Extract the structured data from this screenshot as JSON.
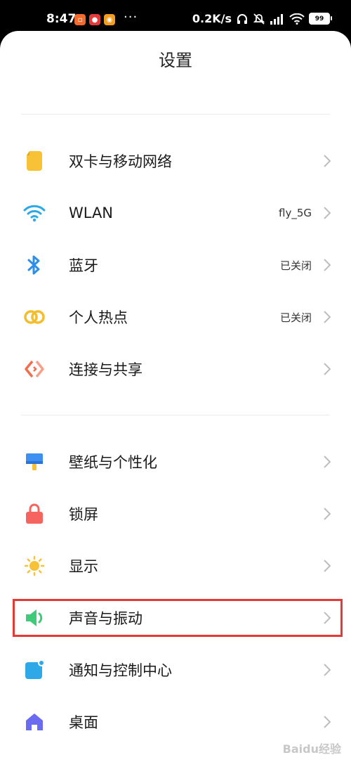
{
  "status_bar": {
    "time": "8:47",
    "more": "···",
    "net_speed": "0.2K/s",
    "battery": "99"
  },
  "page": {
    "title": "设置"
  },
  "section1": [
    {
      "label": "双卡与移动网络",
      "value": "",
      "icon": "sim-card-icon",
      "color": "#F7C235"
    },
    {
      "label": "WLAN",
      "value": "fly_5G",
      "icon": "wifi-icon",
      "color": "#2FA8E8"
    },
    {
      "label": "蓝牙",
      "value": "已关闭",
      "icon": "bluetooth-icon",
      "color": "#2F8FE8"
    },
    {
      "label": "个人热点",
      "value": "已关闭",
      "icon": "hotspot-icon",
      "color": "#F2BE2C"
    },
    {
      "label": "连接与共享",
      "value": "",
      "icon": "connection-share-icon",
      "color": "#F06E4E"
    }
  ],
  "section2": [
    {
      "label": "壁纸与个性化",
      "value": "",
      "icon": "wallpaper-icon",
      "color": "#3E8FF2"
    },
    {
      "label": "锁屏",
      "value": "",
      "icon": "lock-icon",
      "color": "#F5645E"
    },
    {
      "label": "显示",
      "value": "",
      "icon": "brightness-icon",
      "color": "#F7C235"
    },
    {
      "label": "声音与振动",
      "value": "",
      "icon": "speaker-icon",
      "color": "#3FCB7A"
    },
    {
      "label": "通知与控制中心",
      "value": "",
      "icon": "notification-icon",
      "color": "#2FA8E8"
    },
    {
      "label": "桌面",
      "value": "",
      "icon": "home-icon",
      "color": "#6A6BF0"
    }
  ],
  "watermark": "Baidu经验"
}
